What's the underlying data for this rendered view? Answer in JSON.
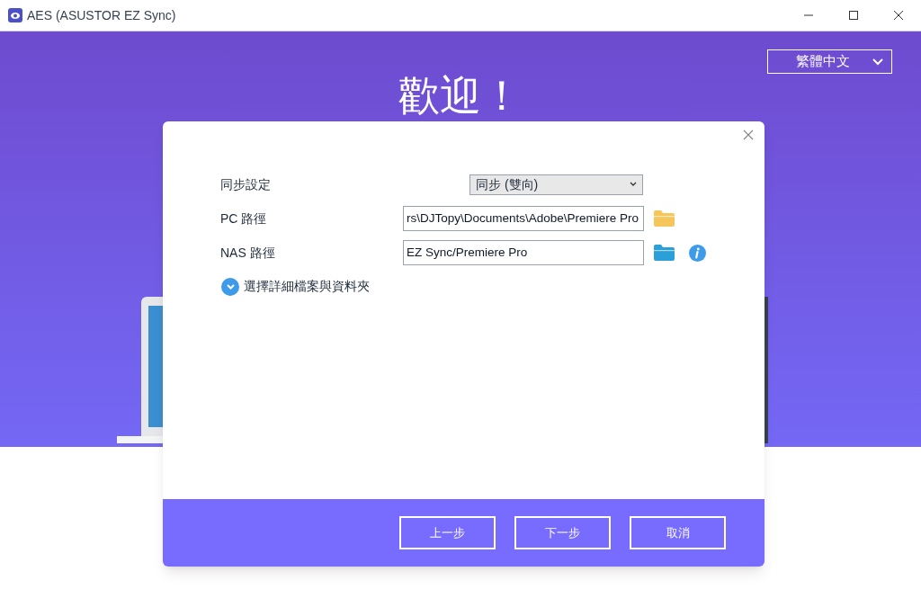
{
  "window": {
    "title": "AES (ASUSTOR EZ Sync)"
  },
  "language": {
    "value": "繁體中文"
  },
  "heading": "歡迎！",
  "dialog": {
    "rows": [
      {
        "kind": "select",
        "label": "同步設定",
        "value": "同步 (雙向)"
      },
      {
        "kind": "path",
        "label": "PC 路徑",
        "value": "rs\\DJTopy\\Documents\\Adobe\\Premiere Pro",
        "color": "#f5c75a",
        "info": false
      },
      {
        "kind": "path",
        "label": "NAS 路徑",
        "value": "EZ Sync/Premiere Pro",
        "color": "#2a9fd8",
        "info": true
      }
    ],
    "expander": {
      "label": "選擇詳細檔案與資料夾",
      "expanded": false
    },
    "buttons": [
      "上一步",
      "下一步",
      "取消"
    ]
  }
}
